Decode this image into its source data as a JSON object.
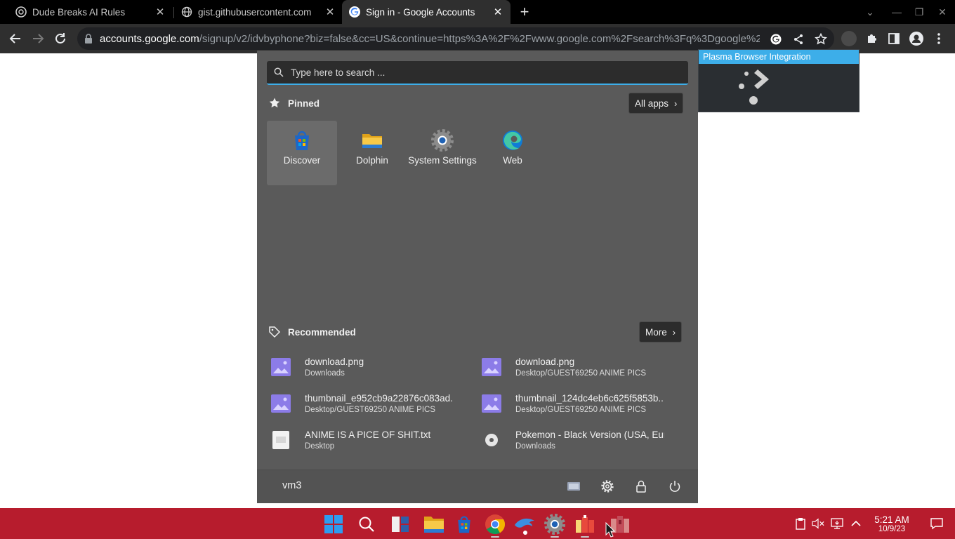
{
  "browser": {
    "tabs": [
      {
        "title": "Dude Breaks AI Rules",
        "icon": "openai-icon",
        "active": false
      },
      {
        "title": "gist.githubusercontent.com",
        "icon": "globe-icon",
        "active": false
      },
      {
        "title": "Sign in - Google Accounts",
        "icon": "google-icon",
        "active": true
      }
    ],
    "url_host": "accounts.google.com",
    "url_path": "/signup/v2/idvbyphone?biz=false&cc=US&continue=https%3A%2F%2Fwww.google.com%2Fsearch%3Fq%3Dgoogle%2..."
  },
  "extension_popup": {
    "title": "Plasma Browser Integration"
  },
  "start_menu": {
    "search_placeholder": "Type here to search ...",
    "pinned_label": "Pinned",
    "all_apps_label": "All apps",
    "pinned_apps": [
      {
        "label": "Discover",
        "icon": "discover-icon",
        "selected": true
      },
      {
        "label": "Dolphin",
        "icon": "folder-icon",
        "selected": false
      },
      {
        "label": "System Settings",
        "icon": "settings-icon",
        "selected": false
      },
      {
        "label": "Web",
        "icon": "edge-icon",
        "selected": false
      }
    ],
    "recommended_label": "Recommended",
    "more_label": "More",
    "recommended": [
      {
        "name": "download.png",
        "path": "Downloads",
        "icon": "image-file-icon"
      },
      {
        "name": "download.png",
        "path": "Desktop/GUEST69250 ANIME PICS",
        "icon": "image-file-icon"
      },
      {
        "name": "thumbnail_e952cb9a22876c083ad...",
        "path": "Desktop/GUEST69250 ANIME PICS",
        "icon": "image-file-icon"
      },
      {
        "name": "thumbnail_124dc4eb6c625f5853b...",
        "path": "Desktop/GUEST69250 ANIME PICS",
        "icon": "image-file-icon"
      },
      {
        "name": "ANIME IS A PICE OF SHIT.txt",
        "path": "Desktop",
        "icon": "text-file-icon"
      },
      {
        "name": "Pokemon - Black Version (USA, Eur...",
        "path": "Downloads",
        "icon": "disc-image-icon"
      }
    ],
    "user_name": "vm3"
  },
  "taskbar": {
    "time": "5:21 AM",
    "date": "10/9/23",
    "color": "#b71c2d"
  },
  "colors": {
    "accent": "#3daee9",
    "menu_bg": "#5a5a5a",
    "chrome_bg": "#2f2f2f"
  }
}
